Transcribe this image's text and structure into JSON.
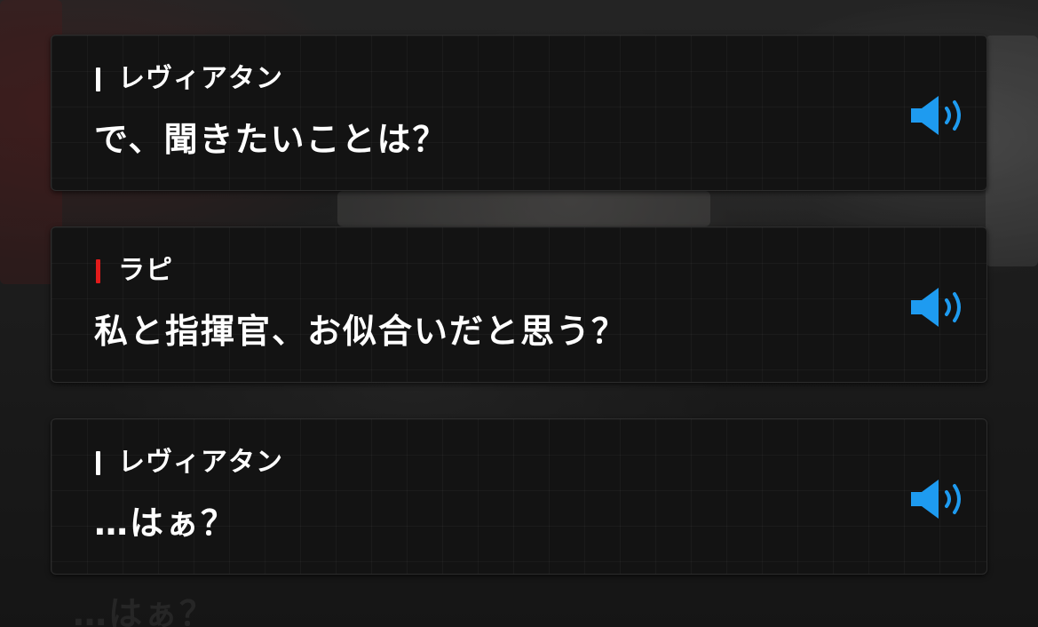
{
  "accent_colors": {
    "speaker_default": "#ffffff",
    "speaker_highlight": "#e21b1b",
    "voice_icon": "#1e9bf0"
  },
  "log": [
    {
      "speaker": "レヴィアタン",
      "speaker_color": "#ffffff",
      "text": "で、聞きたいことは？",
      "voice_icon": "speaker-volume-icon"
    },
    {
      "speaker": "ラピ",
      "speaker_color": "#e21b1b",
      "text": "私と指揮官、お似合いだと思う？",
      "voice_icon": "speaker-volume-icon"
    },
    {
      "speaker": "レヴィアタン",
      "speaker_color": "#ffffff",
      "text": "…はぁ？",
      "voice_icon": "speaker-volume-icon"
    }
  ],
  "background_text": "…はぁ？"
}
